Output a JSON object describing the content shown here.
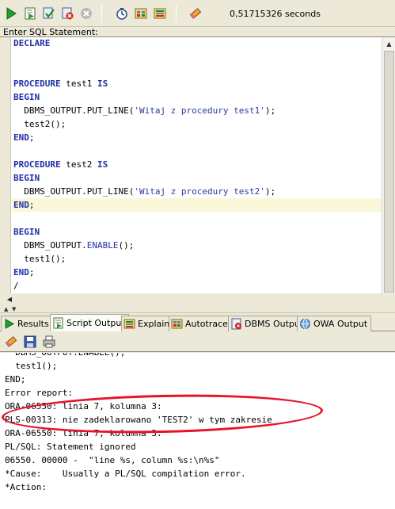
{
  "toolbar": {
    "icons": [
      "run-statement-icon",
      "run-script-icon",
      "commit-icon",
      "rollback-icon",
      "cancel-icon",
      "autotrace-icon",
      "sql-history-icon",
      "explain-plan-icon",
      "clear-icon"
    ],
    "elapsed": "0,51715326 seconds"
  },
  "editor": {
    "label": "Enter SQL Statement:"
  },
  "tabs": [
    {
      "label": "Results"
    },
    {
      "label": "Script Output"
    },
    {
      "label": "Explain"
    },
    {
      "label": "Autotrace"
    },
    {
      "label": "DBMS Output"
    },
    {
      "label": "OWA Output"
    }
  ],
  "output_toolbar": {
    "icons": [
      "clear-output-icon",
      "save-output-icon",
      "print-output-icon"
    ]
  },
  "output": {
    "lines": [
      "  DBMS_OUTPUT.ENABLE();",
      "  test1();",
      "END;",
      "Error report:",
      "ORA-06550: linia 7, kolumna 3:",
      "PLS-00313: nie zadeklarowano 'TEST2' w tym zakresie",
      "ORA-06550: linia 7, kolumna 3:",
      "PL/SQL: Statement ignored",
      "06550. 00000 -  \"line %s, column %s:\\n%s\"",
      "*Cause:    Usually a PL/SQL compilation error.",
      "*Action:"
    ]
  },
  "colors": {
    "keyword": "#1f2fa8",
    "annotation": "#e8132b",
    "current_line": "#fbf8d9"
  }
}
